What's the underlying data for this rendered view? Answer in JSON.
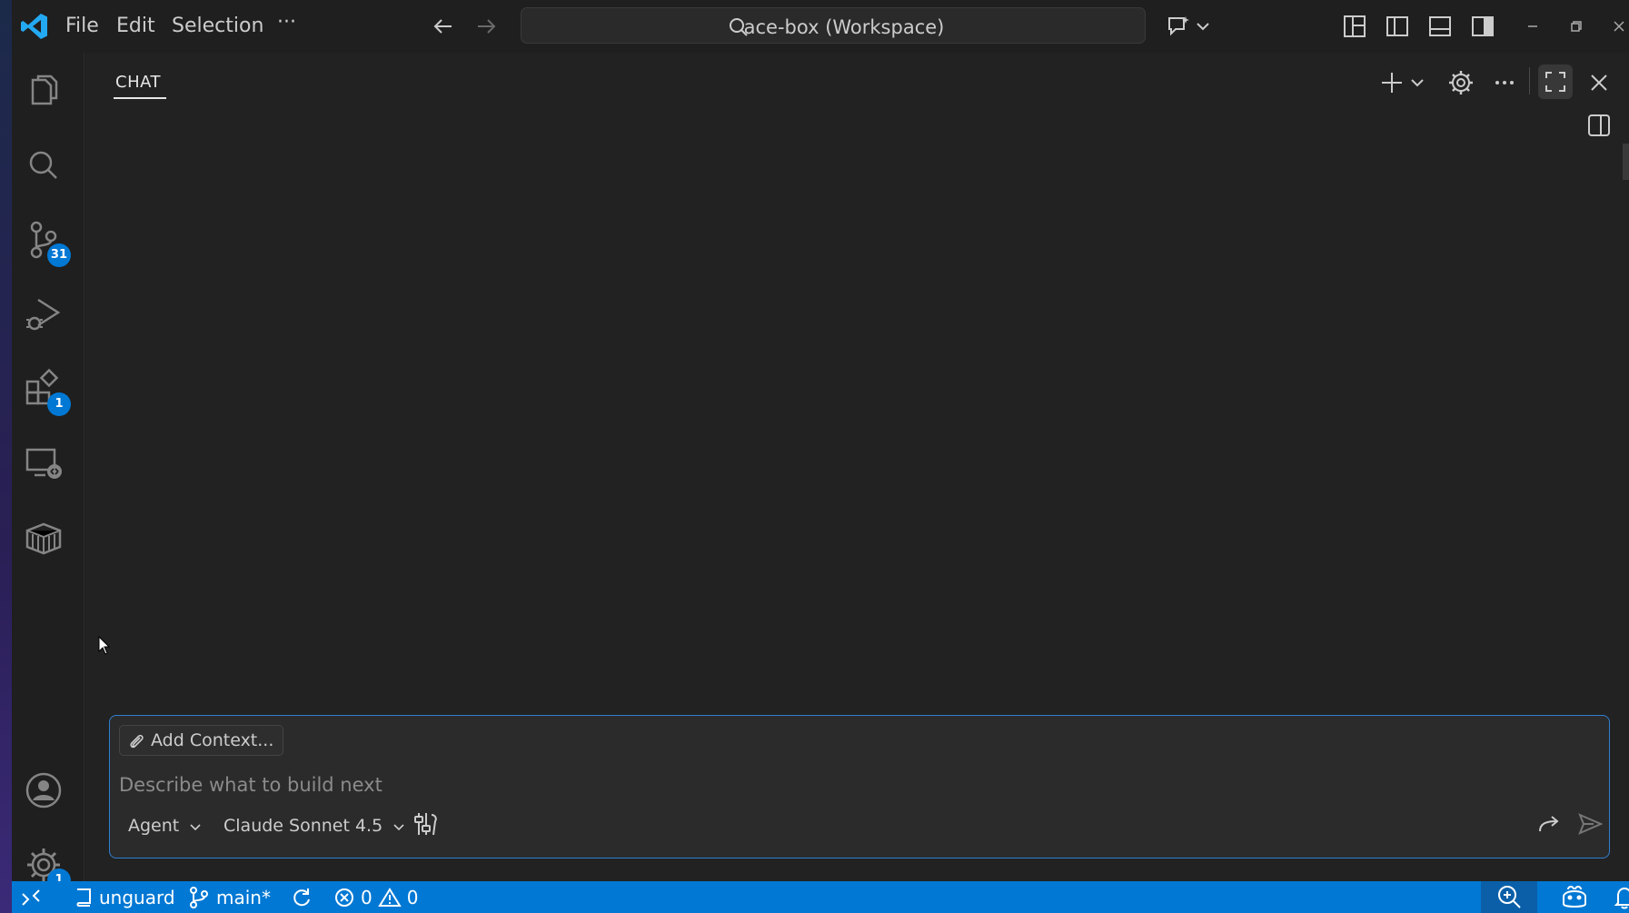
{
  "window": {
    "menu": [
      "File",
      "Edit",
      "Selection",
      "···"
    ],
    "search_label": "ace-box (Workspace)"
  },
  "activity_bar": {
    "source_control_badge": "31",
    "extensions_badge": "1",
    "settings_badge": "1"
  },
  "chat": {
    "tab_label": "CHAT",
    "add_context_label": "Add Context...",
    "input_placeholder": "Describe what to build next",
    "mode_label": "Agent",
    "model_label": "Claude Sonnet 4.5"
  },
  "status_bar": {
    "workspace_label": "unguard",
    "branch_label": "main*",
    "errors_count": "0",
    "warnings_count": "0"
  },
  "colors": {
    "accent": "#0078d4",
    "focus_border": "#2f7fd0",
    "logo": "#23a9f2"
  },
  "icons": [
    "vscode-logo-icon",
    "arrow-left-icon",
    "arrow-right-icon",
    "search-icon",
    "copilot-icon",
    "layout-icon",
    "files-icon",
    "git-icon",
    "debug-icon",
    "extensions-icon",
    "remote-icon",
    "box-icon",
    "account-icon",
    "gear-icon",
    "plus-icon",
    "ellipsis-icon",
    "maximize-icon",
    "close-icon",
    "paperclip-icon",
    "tools-icon",
    "send-icon",
    "bell-icon"
  ]
}
